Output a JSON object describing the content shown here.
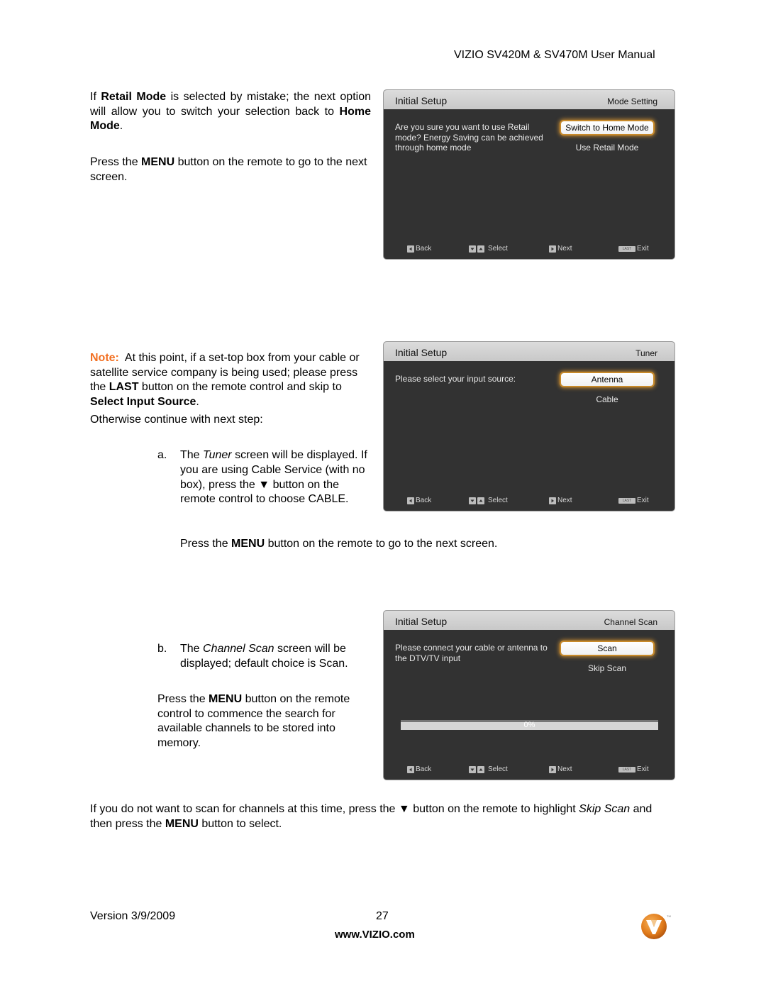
{
  "header": {
    "title": "VIZIO SV420M & SV470M User Manual"
  },
  "section1": {
    "para1": {
      "t1": "If ",
      "b1": "Retail Mode",
      "t2": " is selected by mistake; the next option will allow you to switch your selection back to ",
      "b2": "Home Mode",
      "t3": "."
    },
    "para2": {
      "t1": "Press the ",
      "b1": "MENU",
      "t2": " button on the remote to go to the next screen."
    }
  },
  "section2": {
    "note_label": "Note:",
    "note": {
      "t1": "  At this point, if a set-top box from your cable or satellite service company is being used; please press the ",
      "b1": "LAST",
      "t2": " button on the remote control and skip to ",
      "b2": "Select Input Source",
      "t3": "."
    },
    "otherwise": "Otherwise continue with next step:",
    "step_a": {
      "marker": "a.",
      "t1": "The ",
      "i1": "Tuner",
      "t2": " screen will be displayed.  If you are using Cable Service (with no box), press the ",
      "arrow": "▼",
      "t3": " button on the remote control to choose CABLE."
    },
    "press_menu": {
      "t1": "Press the ",
      "b1": "MENU",
      "t2": " button on the remote to go to the next screen."
    }
  },
  "section3": {
    "step_b": {
      "marker": "b.",
      "t1": "The ",
      "i1": "Channel Scan",
      "t2": " screen will be displayed; default choice is Scan."
    },
    "press_menu": {
      "t1": "Press the ",
      "b1": "MENU",
      "t2": " button on the remote control to commence the search for available channels to be stored into memory."
    }
  },
  "closing": {
    "t1": "If you do not want to scan for channels at this time, press the ",
    "arrow": "▼",
    "t2": " button on the remote to highlight ",
    "i1": "Skip Scan",
    "t3": " and then press the ",
    "b1": "MENU",
    "t4": " button to select."
  },
  "screens": {
    "mode_setting": {
      "title": "Initial Setup",
      "section": "Mode Setting",
      "prompt": "Are you sure you want to use Retail mode? Energy Saving can be achieved through home mode",
      "options": [
        "Switch to Home Mode",
        "Use Retail Mode"
      ],
      "selected": 0
    },
    "tuner": {
      "title": "Initial Setup",
      "section": "Tuner",
      "prompt": "Please select your input source:",
      "options": [
        "Antenna",
        "Cable"
      ],
      "selected": 0
    },
    "channel_scan": {
      "title": "Initial Setup",
      "section": "Channel Scan",
      "prompt": "Please connect your cable or antenna to the DTV/TV input",
      "options": [
        "Scan",
        "Skip Scan"
      ],
      "selected": 0,
      "progress_label": "0%",
      "progress_value": 0
    },
    "footer_keys": {
      "back": "Back",
      "select": "Select",
      "next": "Next",
      "exit": "Exit",
      "last_key": "LAST"
    }
  },
  "footer": {
    "version": "Version 3/9/2009",
    "page": "27",
    "url": "www.VIZIO.com"
  },
  "colors": {
    "note": "#f26f21",
    "screen_bg": "#323232",
    "highlight_glow": "#eba032",
    "logo": "#e8821e"
  }
}
